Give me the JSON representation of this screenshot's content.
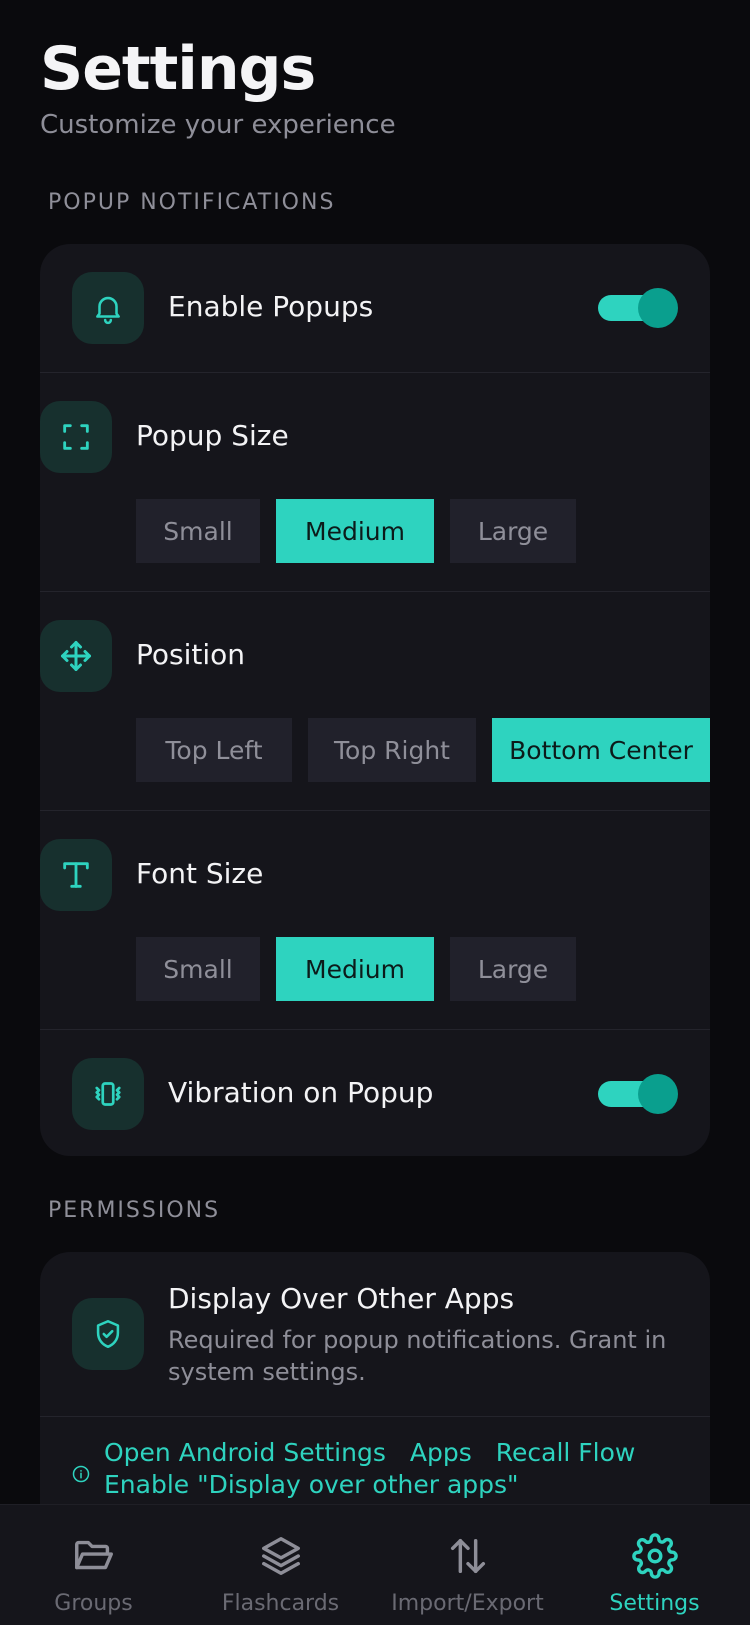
{
  "header": {
    "title": "Settings",
    "subtitle": "Customize your experience"
  },
  "popup_section": {
    "label": "POPUP NOTIFICATIONS",
    "enable_popups": {
      "label": "Enable Popups",
      "icon": "bell-icon",
      "enabled": true
    },
    "popup_size": {
      "label": "Popup Size",
      "icon": "expand-icon",
      "options": [
        "Small",
        "Medium",
        "Large"
      ],
      "selected": "Medium"
    },
    "position": {
      "label": "Position",
      "icon": "move-icon",
      "options": [
        "Top Left",
        "Top Right",
        "Bottom Center"
      ],
      "selected": "Bottom Center"
    },
    "font_size": {
      "label": "Font Size",
      "icon": "type-icon",
      "options": [
        "Small",
        "Medium",
        "Large"
      ],
      "selected": "Medium"
    },
    "vibration": {
      "label": "Vibration on Popup",
      "icon": "vibrate-icon",
      "enabled": true
    }
  },
  "permissions_section": {
    "label": "PERMISSIONS",
    "overlay": {
      "title": "Display Over Other Apps",
      "description": "Required for popup notifications. Grant in system settings.",
      "icon": "shield-check-icon"
    },
    "instructions": {
      "icon": "info-icon",
      "steps": [
        "Open Android Settings",
        "Apps",
        "Recall Flow"
      ],
      "final": "Enable \"Display over other apps\""
    }
  },
  "bottom_nav": {
    "items": [
      {
        "label": "Groups",
        "icon": "folder-open-icon"
      },
      {
        "label": "Flashcards",
        "icon": "layers-icon"
      },
      {
        "label": "Import/Export",
        "icon": "arrows-up-down-icon"
      },
      {
        "label": "Settings",
        "icon": "gear-icon"
      }
    ],
    "active": "Settings"
  },
  "colors": {
    "accent": "#2ed3bf",
    "background": "#0a0a0d",
    "card": "#15151b"
  }
}
